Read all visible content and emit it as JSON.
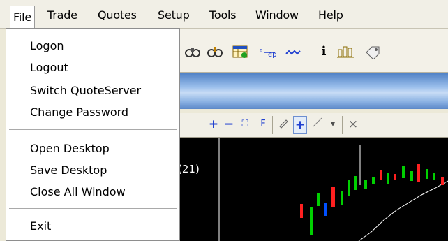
{
  "menubar": {
    "items": [
      {
        "label": "File"
      },
      {
        "label": "Trade"
      },
      {
        "label": "Quotes"
      },
      {
        "label": "Setup"
      },
      {
        "label": "Tools"
      },
      {
        "label": "Window"
      },
      {
        "label": "Help"
      }
    ]
  },
  "file_menu": {
    "group1": [
      "Logon",
      "Logout",
      "Switch QuoteServer",
      "Change Password"
    ],
    "group2": [
      "Open Desktop",
      "Save Desktop",
      "Close All Window"
    ],
    "group3": [
      "Exit"
    ]
  },
  "chart": {
    "indicator_label": "(21)"
  },
  "chart_toolbar": {
    "plus": "+",
    "minus": "−",
    "fit": "⛶",
    "f_label": "F",
    "cross": "+",
    "close": "×",
    "dropdown": "▾"
  },
  "icons": {
    "toolbar": [
      "binoculars-icon",
      "binoculars-2-icon",
      "table-icon",
      "swap-icon",
      "signal-icon",
      "info-icon",
      "bar-chart-icon",
      "tag-icon"
    ]
  },
  "colors": {
    "up_candle": "#00d000",
    "down_candle": "#ff2020",
    "ma_line": "#ffffff",
    "chart_bg": "#000000",
    "blue_band": "#6f9ad6"
  }
}
